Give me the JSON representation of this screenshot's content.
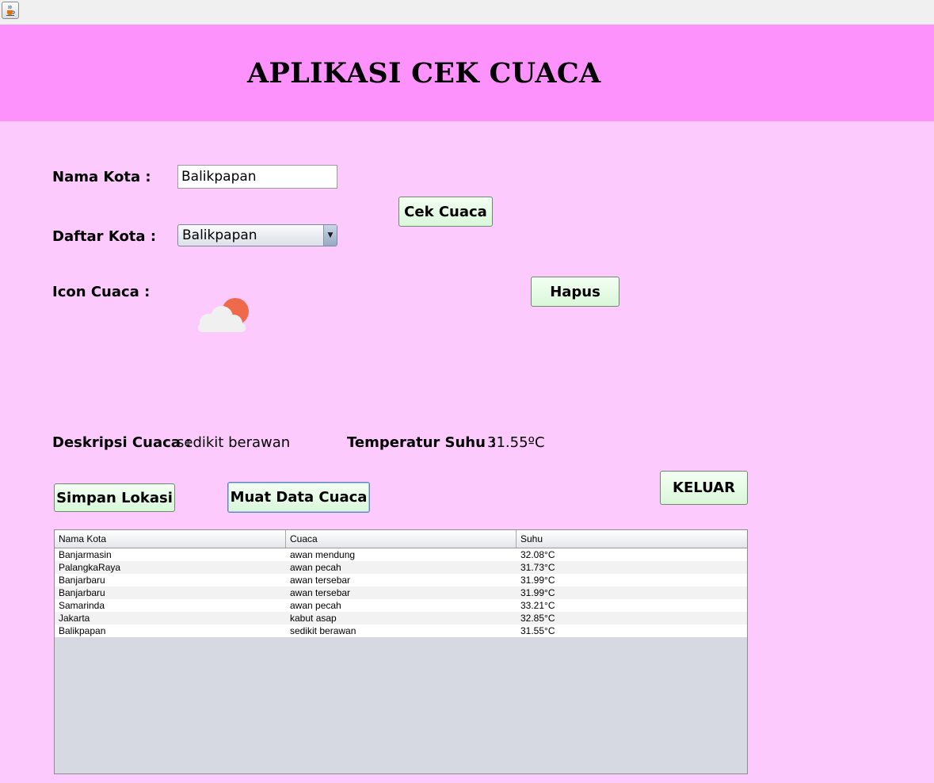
{
  "window": {
    "java_icon": "java-cup-icon"
  },
  "header": {
    "title": "APLIKASI CEK CUACA",
    "background": "#fd92fd"
  },
  "form": {
    "nama_kota_label": "Nama Kota :",
    "nama_kota_value": "Balikpapan",
    "daftar_kota_label": "Daftar Kota :",
    "daftar_kota_selected": "Balikpapan",
    "icon_cuaca_label": "Icon Cuaca  :",
    "weather_icon": "cloud-sun-icon",
    "deskripsi_label": "Deskripsi Cuaca :",
    "deskripsi_value": "sedikit berawan",
    "temperatur_label": "Temperatur Suhu :",
    "temperatur_value": "31.55ºC"
  },
  "buttons": {
    "cek_cuaca": "Cek Cuaca",
    "hapus": "Hapus",
    "simpan_lokasi": "Simpan Lokasi",
    "muat_data": "Muat Data Cuaca",
    "keluar": "KELUAR"
  },
  "table": {
    "headers": [
      "Nama Kota",
      "Cuaca",
      "Suhu"
    ],
    "rows": [
      [
        "Banjarmasin",
        "awan mendung",
        "32.08°C"
      ],
      [
        "PalangkaRaya",
        "awan pecah",
        "31.73°C"
      ],
      [
        "Banjarbaru",
        "awan tersebar",
        "31.99°C"
      ],
      [
        "Banjarbaru",
        "awan tersebar",
        "31.99°C"
      ],
      [
        "Samarinda",
        "awan pecah",
        "33.21°C"
      ],
      [
        "Jakarta",
        "kabut asap",
        "32.85°C"
      ],
      [
        "Balikpapan",
        "sedikit berawan",
        "31.55°C"
      ]
    ]
  },
  "colors": {
    "body_bg": "#fdcafd",
    "button_bg": "#dff8df",
    "sun": "#ef6a4a"
  }
}
